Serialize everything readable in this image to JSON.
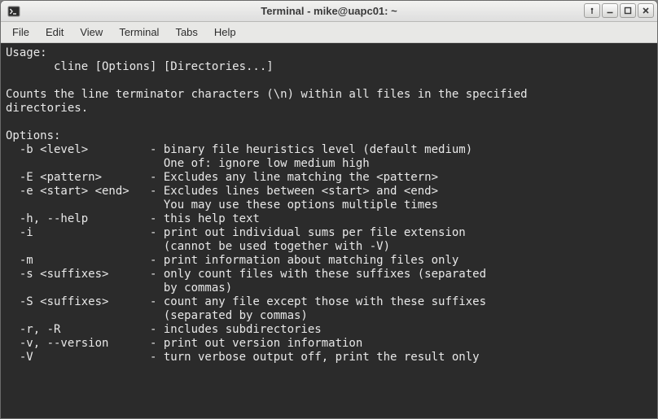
{
  "window": {
    "title": "Terminal - mike@uapc01: ~"
  },
  "menu": {
    "items": [
      "File",
      "Edit",
      "View",
      "Terminal",
      "Tabs",
      "Help"
    ]
  },
  "terminal": {
    "lines": [
      "Usage:",
      "       cline [Options] [Directories...]",
      "",
      "Counts the line terminator characters (\\n) within all files in the specified",
      "directories.",
      "",
      "Options:",
      "  -b <level>         - binary file heuristics level (default medium)",
      "                       One of: ignore low medium high",
      "  -E <pattern>       - Excludes any line matching the <pattern>",
      "  -e <start> <end>   - Excludes lines between <start> and <end>",
      "                       You may use these options multiple times",
      "  -h, --help         - this help text",
      "  -i                 - print out individual sums per file extension",
      "                       (cannot be used together with -V)",
      "  -m                 - print information about matching files only",
      "  -s <suffixes>      - only count files with these suffixes (separated",
      "                       by commas)",
      "  -S <suffixes>      - count any file except those with these suffixes",
      "                       (separated by commas)",
      "  -r, -R             - includes subdirectories",
      "  -v, --version      - print out version information",
      "  -V                 - turn verbose output off, print the result only"
    ]
  }
}
